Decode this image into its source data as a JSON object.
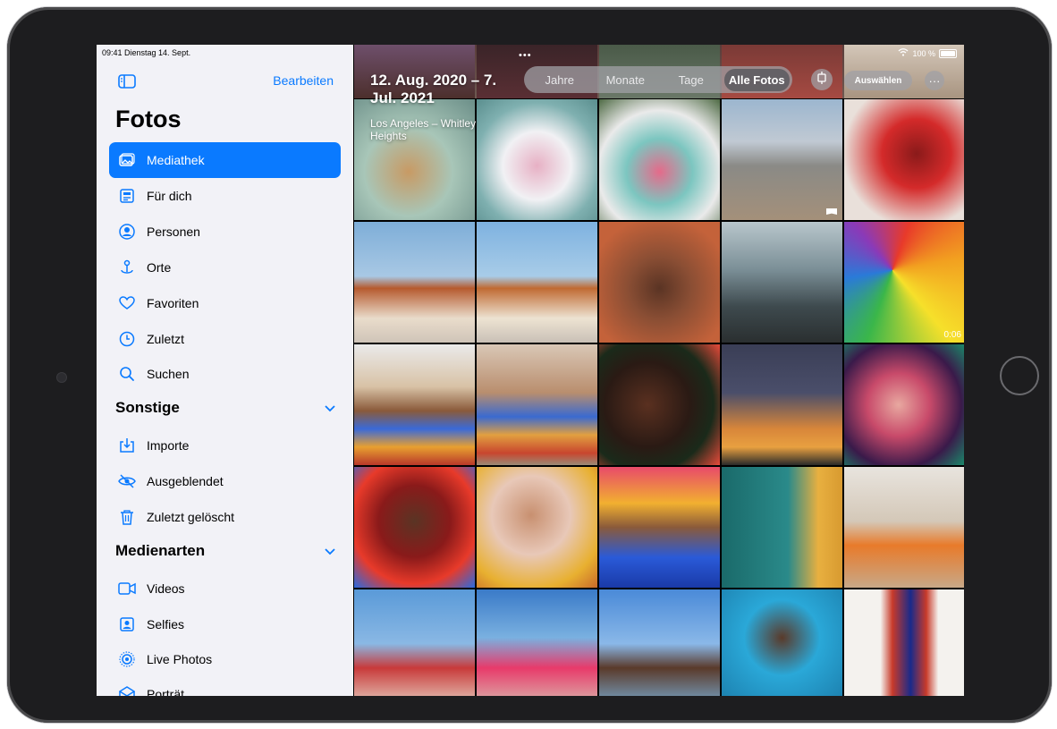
{
  "status": {
    "time_date": "09:41  Dienstag 14. Sept.",
    "battery": "100 %"
  },
  "sidebar": {
    "edit_label": "Bearbeiten",
    "title": "Fotos",
    "items": [
      {
        "label": "Mediathek",
        "icon": "photo-library-icon",
        "selected": true
      },
      {
        "label": "Für dich",
        "icon": "for-you-icon"
      },
      {
        "label": "Personen",
        "icon": "person-icon"
      },
      {
        "label": "Orte",
        "icon": "map-pin-icon"
      },
      {
        "label": "Favoriten",
        "icon": "heart-icon"
      },
      {
        "label": "Zuletzt",
        "icon": "clock-icon"
      },
      {
        "label": "Suchen",
        "icon": "search-icon"
      }
    ],
    "section_other": "Sonstige",
    "other_items": [
      {
        "label": "Importe",
        "icon": "import-icon"
      },
      {
        "label": "Ausgeblendet",
        "icon": "eye-slash-icon"
      },
      {
        "label": "Zuletzt gelöscht",
        "icon": "trash-icon"
      }
    ],
    "section_media": "Medienarten",
    "media_items": [
      {
        "label": "Videos",
        "icon": "video-icon"
      },
      {
        "label": "Selfies",
        "icon": "selfie-icon"
      },
      {
        "label": "Live Photos",
        "icon": "live-photo-icon"
      },
      {
        "label": "Porträt",
        "icon": "portrait-icon"
      }
    ]
  },
  "library": {
    "date_range": "12. Aug. 2020 – 7. Jul. 2021",
    "location": "Los Angeles – Whitley Heights",
    "segments": [
      "Jahre",
      "Monate",
      "Tage",
      "Alle Fotos"
    ],
    "active_segment": "Alle Fotos",
    "select_label": "Auswählen",
    "more_label": "···",
    "video_duration": "0:06"
  },
  "colors": {
    "accent": "#0a7aff",
    "sidebar_bg": "#f2f2f7"
  }
}
